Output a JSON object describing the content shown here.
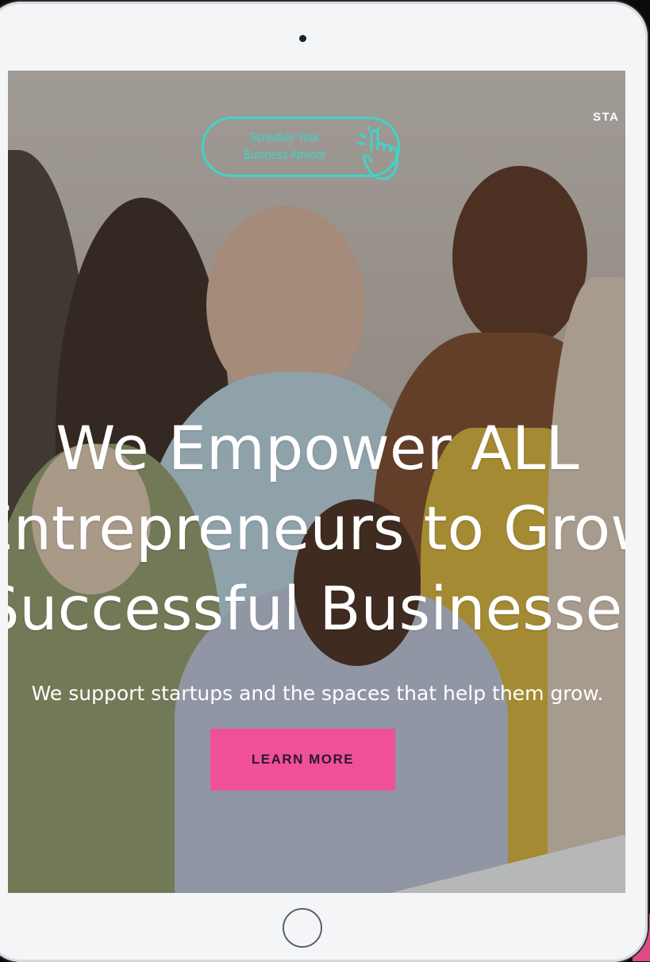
{
  "nav": {
    "partial_label": "STA"
  },
  "schedule": {
    "line1": "Schedule Your",
    "line2": "Business Advisor"
  },
  "hero": {
    "title_lines": [
      "We Empower ALL",
      "Entrepreneurs to Grow",
      "Successful Businesses"
    ],
    "subtitle": "We support startups and the spaces that help them grow.",
    "cta_label": "LEARN MORE"
  },
  "icons": {
    "hand": "pointing-hand-icon"
  },
  "colors": {
    "accent_teal": "#3fd5c8",
    "cta_pink": "#f0509a",
    "frame": "#f4f5f7"
  }
}
